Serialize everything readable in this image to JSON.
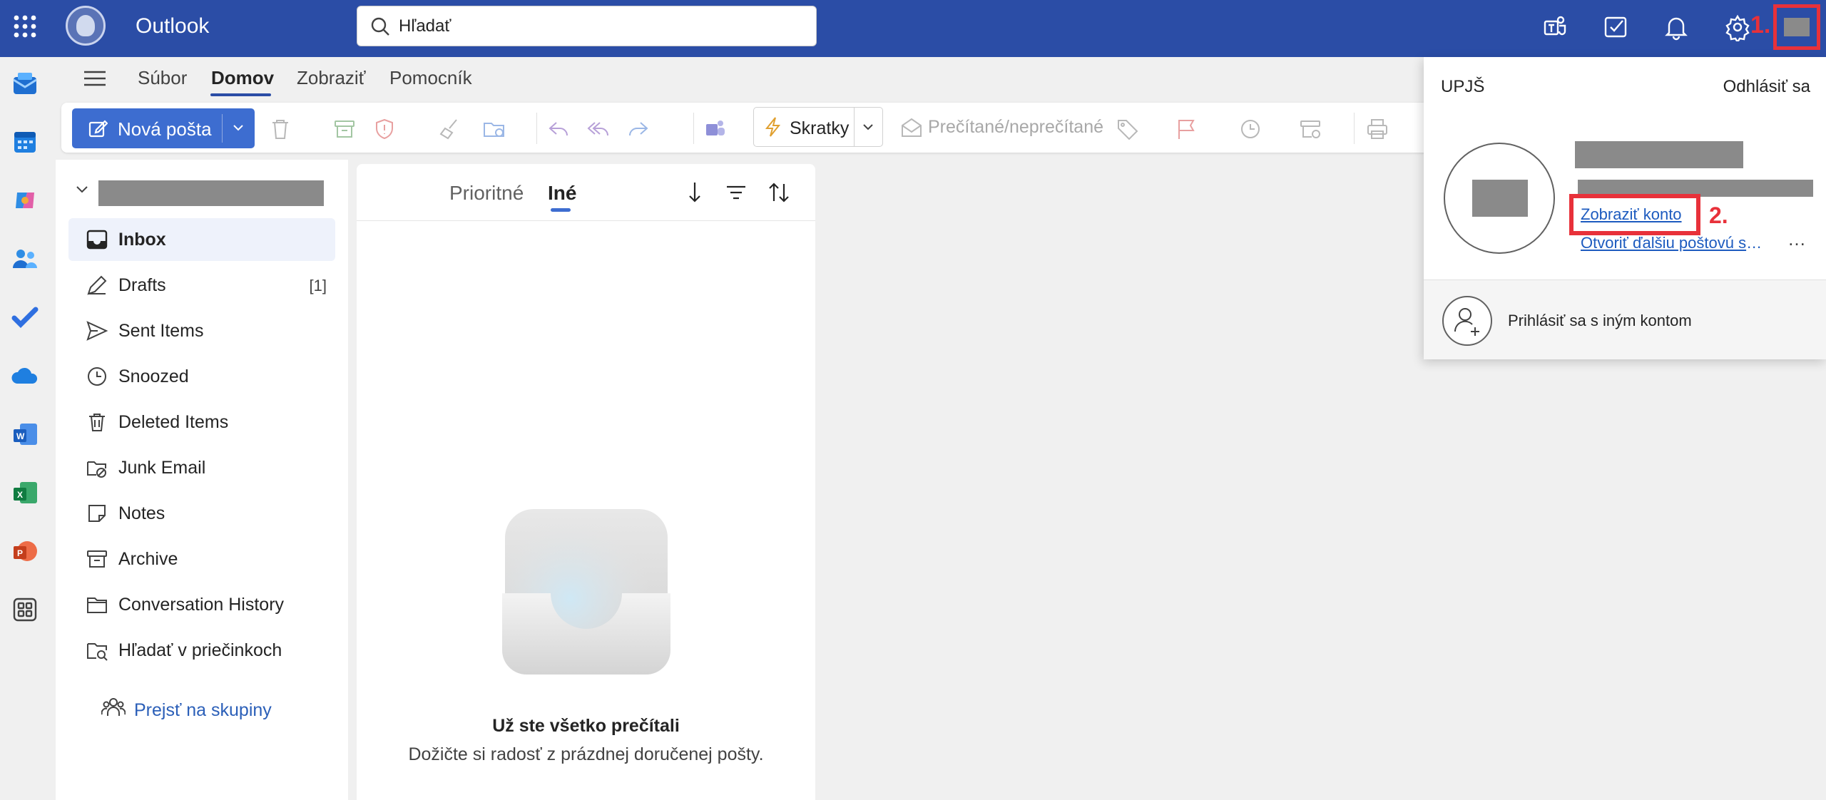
{
  "app": {
    "title": "Outlook"
  },
  "search": {
    "placeholder": "Hľadať"
  },
  "annotations": {
    "step1": "1.",
    "step2": "2."
  },
  "menu": {
    "tabs": [
      "Súbor",
      "Domov",
      "Zobraziť",
      "Pomocník"
    ],
    "active": "Domov"
  },
  "ribbon": {
    "new_mail": "Nová pošta",
    "shortcuts": "Skratky",
    "read_unread": "Prečítané/neprečítané"
  },
  "folders": {
    "items": [
      {
        "label": "Inbox",
        "icon": "inbox-icon",
        "count": ""
      },
      {
        "label": "Drafts",
        "icon": "drafts-icon",
        "count": "[1]"
      },
      {
        "label": "Sent Items",
        "icon": "send-icon",
        "count": ""
      },
      {
        "label": "Snoozed",
        "icon": "clock-icon",
        "count": ""
      },
      {
        "label": "Deleted Items",
        "icon": "trash-icon",
        "count": ""
      },
      {
        "label": "Junk Email",
        "icon": "junk-icon",
        "count": ""
      },
      {
        "label": "Notes",
        "icon": "note-icon",
        "count": ""
      },
      {
        "label": "Archive",
        "icon": "archive-icon",
        "count": ""
      },
      {
        "label": "Conversation History",
        "icon": "folder-icon",
        "count": ""
      },
      {
        "label": "Hľadať v priečinkoch",
        "icon": "search-folder-icon",
        "count": ""
      }
    ],
    "groups_link": "Prejsť na skupiny"
  },
  "message_list": {
    "tabs": [
      "Prioritné",
      "Iné"
    ],
    "active_tab": "Iné",
    "empty_title": "Už ste všetko prečítali",
    "empty_subtitle": "Dožičte si radosť z prázdnej doručenej pošty."
  },
  "account_popup": {
    "org": "UPJŠ",
    "sign_out": "Odhlásiť sa",
    "view_account": "Zobraziť konto",
    "open_mailbox": "Otvoriť ďalšiu poštovú schránku",
    "more": "…",
    "other_account": "Prihlásiť sa s iným kontom"
  },
  "colors": {
    "header": "#2b4da6",
    "accent": "#3d6dd0",
    "annotation": "#e8313a"
  }
}
